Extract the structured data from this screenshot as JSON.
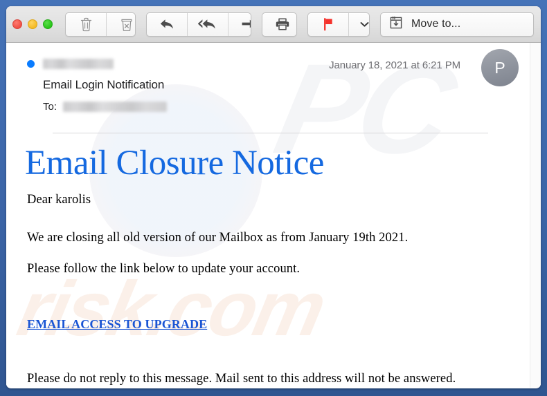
{
  "window": {
    "frame_color": "#3b64a6",
    "traffic_lights": [
      {
        "name": "close",
        "color": "#ef4f45"
      },
      {
        "name": "minimize",
        "color": "#f4bb26"
      },
      {
        "name": "zoom",
        "color": "#28c518"
      }
    ]
  },
  "toolbar": {
    "groups": [
      {
        "buttons": [
          {
            "icon": "trash-icon",
            "label": "Delete"
          },
          {
            "icon": "junk-icon",
            "label": "Mark as Junk"
          }
        ]
      },
      {
        "buttons": [
          {
            "icon": "reply-icon",
            "label": "Reply"
          },
          {
            "icon": "reply-all-icon",
            "label": "Reply All"
          },
          {
            "icon": "forward-icon",
            "label": "Forward"
          }
        ]
      },
      {
        "buttons": [
          {
            "icon": "printer-icon",
            "label": "Print"
          }
        ]
      },
      {
        "buttons": [
          {
            "icon": "flag-icon",
            "label": "Flag"
          },
          {
            "icon": "chevron-down-icon",
            "label": "Flag options"
          }
        ]
      }
    ],
    "move_to": {
      "icon": "archive-box-icon",
      "label": "Move to..."
    }
  },
  "message": {
    "unread": true,
    "sender_redacted": true,
    "recipient_redacted": true,
    "subject": "Email Login Notification",
    "to_label": "To:",
    "date": "January 18, 2021 at 6:21 PM",
    "avatar_initial": "P",
    "body": {
      "title": "Email Closure Notice",
      "title_color": "#1569e0",
      "greeting": "Dear karolis",
      "paragraph_1": "We are closing all old version of our Mailbox as from January 19th 2021.",
      "paragraph_2": "Please follow the link below to update your account.",
      "link_text": "EMAIL ACCESS TO UPGRADE",
      "link_color": "#1a55d4",
      "paragraph_3": "Please do not reply to this message. Mail sent to this address will not be answered."
    }
  },
  "watermarks": {
    "primary": "PC",
    "secondary": "risk.com"
  }
}
